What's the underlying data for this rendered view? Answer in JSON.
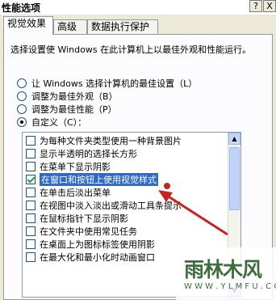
{
  "window": {
    "title": "性能选项",
    "help_btn": "?",
    "close_btn": "X"
  },
  "tabs": [
    {
      "label": "视觉效果"
    },
    {
      "label": "高级"
    },
    {
      "label": "数据执行保护"
    }
  ],
  "description": "选择设置使 Windows 在此计算机上以最佳外观和性能运行。",
  "radios": [
    {
      "label": "让 Windows 选择计算机的最佳设置（L）",
      "checked": false
    },
    {
      "label": "调整为最佳外观（B）",
      "checked": false
    },
    {
      "label": "调整为最佳性能（P）",
      "checked": false
    },
    {
      "label": "自定义（C）：",
      "checked": true
    }
  ],
  "effects": [
    {
      "label": "为每种文件夹类型使用一种背景图片",
      "checked": false
    },
    {
      "label": "显示半透明的选择长方形",
      "checked": false
    },
    {
      "label": "在菜单下显示阴影",
      "checked": false
    },
    {
      "label": "在窗口和按钮上使用视觉样式",
      "checked": true,
      "selected": true
    },
    {
      "label": "在单击后淡出菜单",
      "checked": false
    },
    {
      "label": "在视图中淡入淡出或滑动工具条提示",
      "checked": false
    },
    {
      "label": "在鼠标指针下显示阴影",
      "checked": false
    },
    {
      "label": "在文件夹中使用常见任务",
      "checked": false
    },
    {
      "label": "在桌面上为图标标签使用阴影",
      "checked": false
    },
    {
      "label": "在最大化和最小化时动画窗口",
      "checked": false
    }
  ],
  "watermark": {
    "main": "雨林木风",
    "sub": "W W W . Y L M F U . C O M"
  },
  "colors": {
    "selection": "#316ac5",
    "arrow": "#c8241f",
    "watermark": "#3d6c3d"
  }
}
